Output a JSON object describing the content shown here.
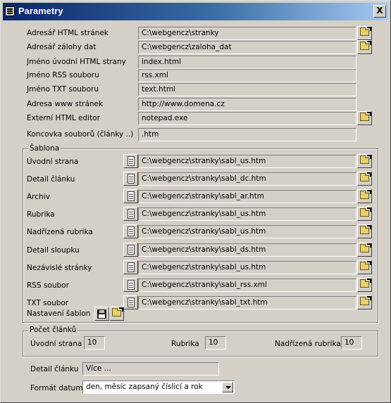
{
  "window": {
    "title": "Parametry",
    "close": "X"
  },
  "main_fields": [
    {
      "label": "Adresář HTML stránek",
      "value": "C:\\webgencz\\stranky",
      "browse": true
    },
    {
      "label": "Adresář zálohy dat",
      "value": "C:\\webgencz\\zaloha_dat",
      "browse": true
    },
    {
      "label": "Jméno úvodní HTML strany",
      "value": "index.html",
      "browse": false
    },
    {
      "label": "Jméno RSS souboru",
      "value": "rss.xml",
      "browse": false
    },
    {
      "label": "Jméno TXT souboru",
      "value": "text.html",
      "browse": false
    },
    {
      "label": "Adresa www stránek",
      "value": "http://www.domena.cz",
      "browse": false
    },
    {
      "label": "Externí HTML editor",
      "value": "notepad.exe",
      "browse": true
    },
    {
      "label": "Koncovka souborů (články ..)",
      "value": ".htm",
      "browse": false
    }
  ],
  "sablona": {
    "legend": "Šablona",
    "rows": [
      {
        "label": "Úvodní strana",
        "value": "C:\\webgencz\\stranky\\sabl_us.htm"
      },
      {
        "label": "Detail článku",
        "value": "C:\\webgencz\\stranky\\sabl_dc.htm"
      },
      {
        "label": "Archiv",
        "value": "C:\\webgencz\\stranky\\sabl_ar.htm"
      },
      {
        "label": "Rubrika",
        "value": "C:\\webgencz\\stranky\\sabl_us.htm"
      },
      {
        "label": "Nadřízená rubrika",
        "value": "C:\\webgencz\\stranky\\sabl_us.htm"
      },
      {
        "label": "Detail sloupku",
        "value": "C:\\webgencz\\stranky\\sabl_ds.htm"
      },
      {
        "label": "Nezávislé stránky",
        "value": "C:\\webgencz\\stranky\\sabl_us.htm"
      },
      {
        "label": "RSS soubor",
        "value": "C:\\webgencz\\stranky\\sabl_rss.xml"
      },
      {
        "label": "TXT soubor",
        "value": "C:\\webgencz\\stranky\\sabl_txt.htm"
      }
    ],
    "settings_label": "Nastavení šablon"
  },
  "pocet": {
    "legend": "Počet článků",
    "uvodni_label": "Úvodní strana",
    "uvodni_value": "10",
    "rubrika_label": "Rubrika",
    "rubrika_value": "10",
    "nadrizena_label": "Nadřízená rubrika",
    "nadrizena_value": "10"
  },
  "detail": {
    "label": "Detail článku",
    "value": "Více ..."
  },
  "format": {
    "label": "Formát datumu",
    "value": "den, měsíc zapsaný číslicí a rok"
  },
  "icons": {
    "browse": "folder-open-icon",
    "edit": "document-icon",
    "save": "floppy-disk-icon",
    "close": "close-icon"
  }
}
